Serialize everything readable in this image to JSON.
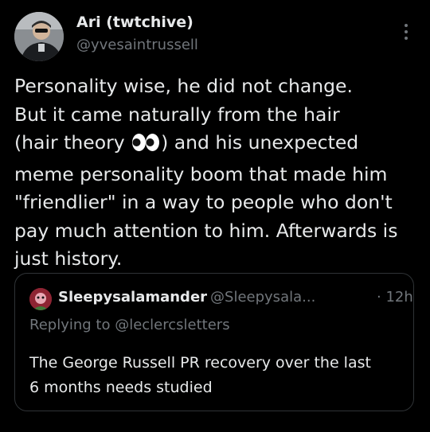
{
  "author": {
    "display_name": "Ari (twtchive)",
    "handle": "@yvesaintrussell"
  },
  "tweet": {
    "lines": [
      "Personality wise, he did not change.",
      "But it came naturally from the hair",
      "(hair theory ",
      ") and his unexpected",
      "meme personality boom that made him",
      "\"friendlier\" in a way to people who don't",
      "pay much attention to him. Afterwards is",
      "just history."
    ],
    "emoji": "eyes"
  },
  "quoted_tweet": {
    "display_name": "Sleepysalamander",
    "handle": "@Sleepysala...",
    "time": "· 12h",
    "replying_to": "Replying to @leclercsletters",
    "text_lines": [
      "The George Russell PR recovery over the last",
      "6 months needs studied"
    ]
  },
  "icons": {
    "more": "more-vertical-icon",
    "emoji": "eyes-emoji-icon"
  },
  "colors": {
    "background": "#000000",
    "text_primary": "#e7e9ea",
    "text_secondary": "#71767b",
    "border": "#2f3336"
  }
}
